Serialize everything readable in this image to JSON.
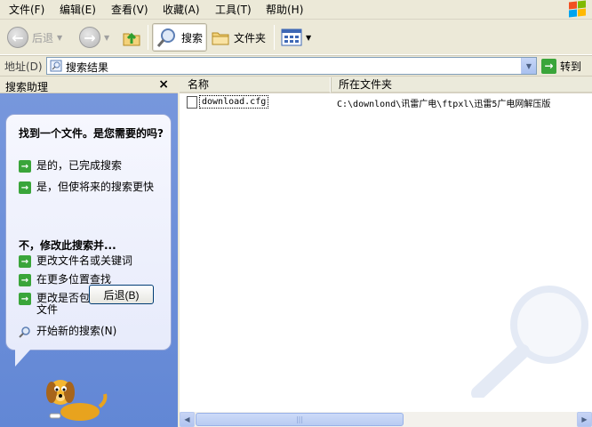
{
  "menu": {
    "items": [
      "文件(F)",
      "编辑(E)",
      "查看(V)",
      "收藏(A)",
      "工具(T)",
      "帮助(H)"
    ]
  },
  "toolbar": {
    "back_label": "后退",
    "search_label": "搜索",
    "folders_label": "文件夹"
  },
  "address": {
    "label": "地址(D)",
    "value": "搜索结果",
    "go_label": "转到"
  },
  "search_companion": {
    "title": "搜索助理",
    "question": "找到一个文件。是您需要的吗?",
    "options": [
      "是的，已完成搜索",
      "是，但使将来的搜索更快"
    ],
    "refine_title": "不，修改此搜索并...",
    "refine_options": [
      "更改文件名或关键词",
      "在更多位置查找",
      "更改是否包括隐藏和系统文件"
    ],
    "new_search_label": "开始新的搜索(N)",
    "back_button": "后退(B)"
  },
  "results": {
    "columns": [
      "名称",
      "所在文件夹"
    ],
    "rows": [
      {
        "name": "download.cfg",
        "folder": "C:\\downlond\\讯雷广电\\ftpxl\\迅雷5广电网解压版"
      }
    ]
  },
  "colors": {
    "accent_green": "#3aa53a",
    "pane_blue": "#6b8ed6",
    "chrome": "#ece9d8"
  }
}
